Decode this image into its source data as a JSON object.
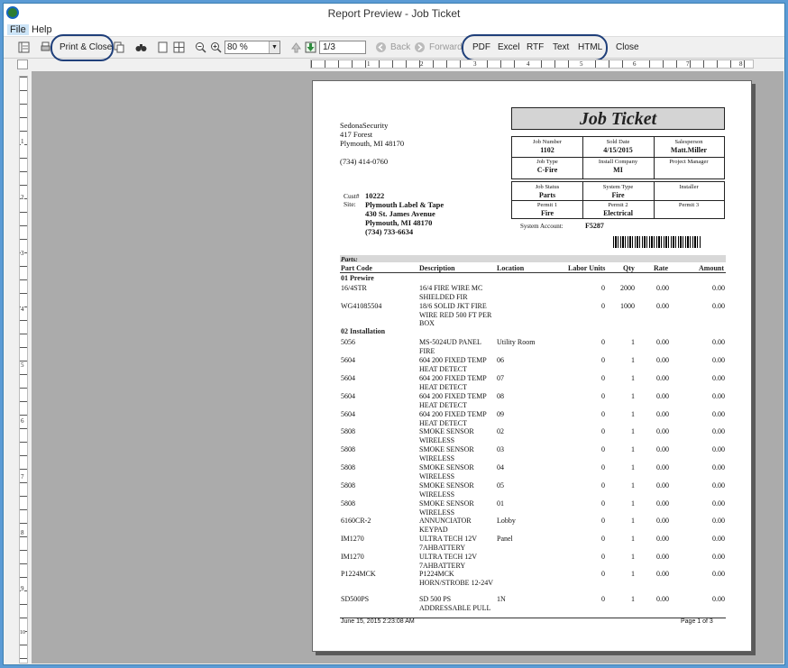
{
  "window": {
    "title": "Report Preview - Job Ticket"
  },
  "menu": {
    "file": "File",
    "help": "Help"
  },
  "toolbar": {
    "print_close": "Print & Close",
    "zoom": "80 %",
    "page": "1/3",
    "back": "Back",
    "forward": "Forward",
    "pdf": "PDF",
    "excel": "Excel",
    "rtf": "RTF",
    "text": "Text",
    "html": "HTML",
    "close": "Close"
  },
  "ruler": {
    "h": [
      "1",
      "2",
      "3",
      "4",
      "5",
      "6",
      "7",
      "8"
    ],
    "v": [
      "1",
      "2",
      "3",
      "4",
      "5",
      "6",
      "7",
      "8",
      "9",
      "10"
    ]
  },
  "company": {
    "name": "SedonaSecurity",
    "addr1": "417 Forest",
    "addr2": "Plymouth, MI  48170",
    "phone": "(734) 414-0760"
  },
  "customer": {
    "cust_label": "Cust#",
    "cust": "10222",
    "site_label": "Site:",
    "name": "Plymouth Label & Tape",
    "addr1": "430 St. James Avenue",
    "addr2": "Plymouth, MI  48170",
    "phone": "(734) 733-6634"
  },
  "ticket": {
    "title": "Job Ticket",
    "job_number_label": "Job Number",
    "job_number": "1102",
    "sold_date_label": "Sold Date",
    "sold_date": "4/15/2015",
    "salesperson_label": "Salesperson",
    "salesperson": "Matt.Miller",
    "job_type_label": "Job Type",
    "job_type": "C-Fire",
    "install_company_label": "Install Company",
    "install_company": "MI",
    "project_manager_label": "Project Manager",
    "project_manager": "",
    "job_status_label": "Job Status",
    "job_status": "Parts",
    "system_type_label": "System Type",
    "system_type": "Fire",
    "installer_label": "Installer",
    "installer": "",
    "permit1_label": "Permit 1",
    "permit1": "Fire",
    "permit2_label": "Permit 2",
    "permit2": "Electrical",
    "permit3_label": "Permit 3",
    "permit3": "",
    "system_account_label": "System Account:",
    "system_account": "F5287"
  },
  "parts": {
    "section": "Parts:",
    "headers": {
      "code": "Part Code",
      "desc": "Description",
      "loc": "Location",
      "labor": "Labor Units",
      "qty": "Qty",
      "rate": "Rate",
      "amount": "Amount"
    },
    "groups": [
      "01 Prewire",
      "02 Installation"
    ],
    "rows": [
      {
        "code": "16/4STR",
        "desc": "16/4 FIRE WIRE MC SHIELDED FIR",
        "loc": "",
        "labor": "0",
        "qty": "2000",
        "rate": "0.00",
        "amount": "0.00"
      },
      {
        "code": "WG41085504",
        "desc": "18/6 SOLID JKT FIRE WIRE RED 500 FT PER BOX",
        "loc": "",
        "labor": "0",
        "qty": "1000",
        "rate": "0.00",
        "amount": "0.00"
      },
      {
        "code": "5056",
        "desc": "MS-5024UD PANEL FIRE",
        "loc": "Utility Room",
        "labor": "0",
        "qty": "1",
        "rate": "0.00",
        "amount": "0.00"
      },
      {
        "code": "5604",
        "desc": "604 200 FIXED TEMP HEAT DETECT",
        "loc": "06",
        "labor": "0",
        "qty": "1",
        "rate": "0.00",
        "amount": "0.00"
      },
      {
        "code": "5604",
        "desc": "604 200 FIXED TEMP HEAT DETECT",
        "loc": "07",
        "labor": "0",
        "qty": "1",
        "rate": "0.00",
        "amount": "0.00"
      },
      {
        "code": "5604",
        "desc": "604 200 FIXED TEMP HEAT DETECT",
        "loc": "08",
        "labor": "0",
        "qty": "1",
        "rate": "0.00",
        "amount": "0.00"
      },
      {
        "code": "5604",
        "desc": "604 200 FIXED TEMP HEAT DETECT",
        "loc": "09",
        "labor": "0",
        "qty": "1",
        "rate": "0.00",
        "amount": "0.00"
      },
      {
        "code": "5808",
        "desc": "SMOKE SENSOR WIRELESS",
        "loc": "02",
        "labor": "0",
        "qty": "1",
        "rate": "0.00",
        "amount": "0.00"
      },
      {
        "code": "5808",
        "desc": "SMOKE SENSOR WIRELESS",
        "loc": "03",
        "labor": "0",
        "qty": "1",
        "rate": "0.00",
        "amount": "0.00"
      },
      {
        "code": "5808",
        "desc": "SMOKE SENSOR WIRELESS",
        "loc": "04",
        "labor": "0",
        "qty": "1",
        "rate": "0.00",
        "amount": "0.00"
      },
      {
        "code": "5808",
        "desc": "SMOKE SENSOR WIRELESS",
        "loc": "05",
        "labor": "0",
        "qty": "1",
        "rate": "0.00",
        "amount": "0.00"
      },
      {
        "code": "5808",
        "desc": "SMOKE SENSOR WIRELESS",
        "loc": "01",
        "labor": "0",
        "qty": "1",
        "rate": "0.00",
        "amount": "0.00"
      },
      {
        "code": "6160CR-2",
        "desc": "ANNUNCIATOR KEYPAD",
        "loc": "Lobby",
        "labor": "0",
        "qty": "1",
        "rate": "0.00",
        "amount": "0.00"
      },
      {
        "code": "IM1270",
        "desc": "ULTRA TECH 12V 7AHBATTERY",
        "loc": "Panel",
        "labor": "0",
        "qty": "1",
        "rate": "0.00",
        "amount": "0.00"
      },
      {
        "code": "IM1270",
        "desc": "ULTRA TECH 12V 7AHBATTERY",
        "loc": "",
        "labor": "0",
        "qty": "1",
        "rate": "0.00",
        "amount": "0.00"
      },
      {
        "code": "P1224MCK",
        "desc": "P1224MCK HORN/STROBE 12-24V",
        "loc": "",
        "labor": "0",
        "qty": "1",
        "rate": "0.00",
        "amount": "0.00"
      },
      {
        "code": "SD500PS",
        "desc": "SD 500 PS ADDRESSABLE PULL",
        "loc": "1N",
        "labor": "0",
        "qty": "1",
        "rate": "0.00",
        "amount": "0.00"
      }
    ]
  },
  "footer": {
    "date": "June 15, 2015 2:23:08 AM",
    "page": "Page 1  of  3"
  }
}
